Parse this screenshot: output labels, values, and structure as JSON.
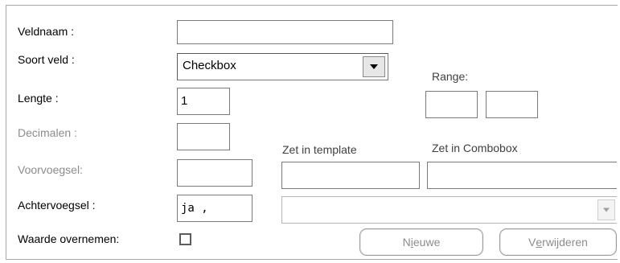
{
  "form": {
    "veldnaam_label": "Veldnaam :",
    "veldnaam_value": "",
    "soort_veld_label": "Soort veld :",
    "soort_veld_value": "Checkbox",
    "range_label": "Range:",
    "range_from": "",
    "range_to": "",
    "lengte_label": "Lengte :",
    "lengte_value": "1",
    "decimalen_label": "Decimalen :",
    "decimalen_value": "",
    "voorvoegsel_label": "Voorvoegsel:",
    "voorvoegsel_value": "",
    "zet_in_template_label": "Zet in template",
    "zet_in_template_value": "",
    "zet_in_combobox_label": "Zet in Combobox",
    "zet_in_combobox_value": "",
    "achtervoegsel_label": "Achtervoegsel :",
    "achtervoegsel_value": "ja ,",
    "combobox_value": "",
    "waarde_overnemen_label": "Waarde overnemen:",
    "waarde_overnemen_checked": false
  },
  "buttons": {
    "nieuwe_pre": "N",
    "nieuwe_mnemonic": "i",
    "nieuwe_post": "euwe",
    "verwijderen_pre": "V",
    "verwijderen_mnemonic": "e",
    "verwijderen_post": "rwijderen"
  },
  "icons": {
    "dropdown": "chevron-down-icon"
  },
  "colors": {
    "disabled_text": "#8c8c8c",
    "border": "#7a7a7a"
  }
}
